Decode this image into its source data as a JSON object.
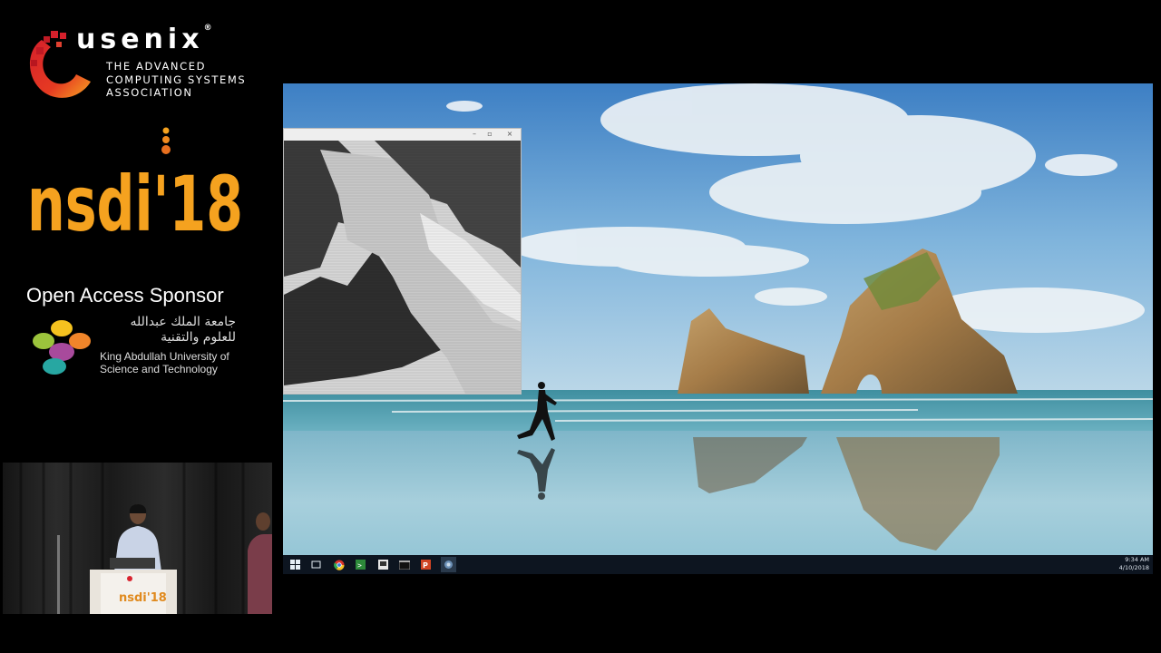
{
  "branding": {
    "org_name": "usenix",
    "registered_mark": "®",
    "org_tagline": "THE ADVANCED\nCOMPUTING SYSTEMS\nASSOCIATION",
    "conference_logo": "nsdi'18",
    "colors": {
      "usenix_red": "#d9242f",
      "nsdi_orange": "#f5a21f"
    }
  },
  "sponsor": {
    "label": "Open Access Sponsor",
    "arabic_name": "جامعة الملك عبدالله\nللعلوم والتقنية",
    "name": "King Abdullah University of\nScience and Technology"
  },
  "speaker_video": {
    "podium_text": "nsdi'18"
  },
  "desktop": {
    "window": {
      "title": "",
      "minimize_icon": "minimize-icon",
      "maximize_icon": "maximize-icon",
      "close_icon": "close-icon"
    },
    "taskbar": {
      "icons": [
        "windows-start-icon",
        "task-view-icon",
        "chrome-icon",
        "terminal-icon",
        "sticky-notes-icon",
        "cmd-icon",
        "powerpoint-icon",
        "app-icon"
      ],
      "clock_time": "9:34 AM",
      "clock_date": "4/10/2018"
    }
  }
}
